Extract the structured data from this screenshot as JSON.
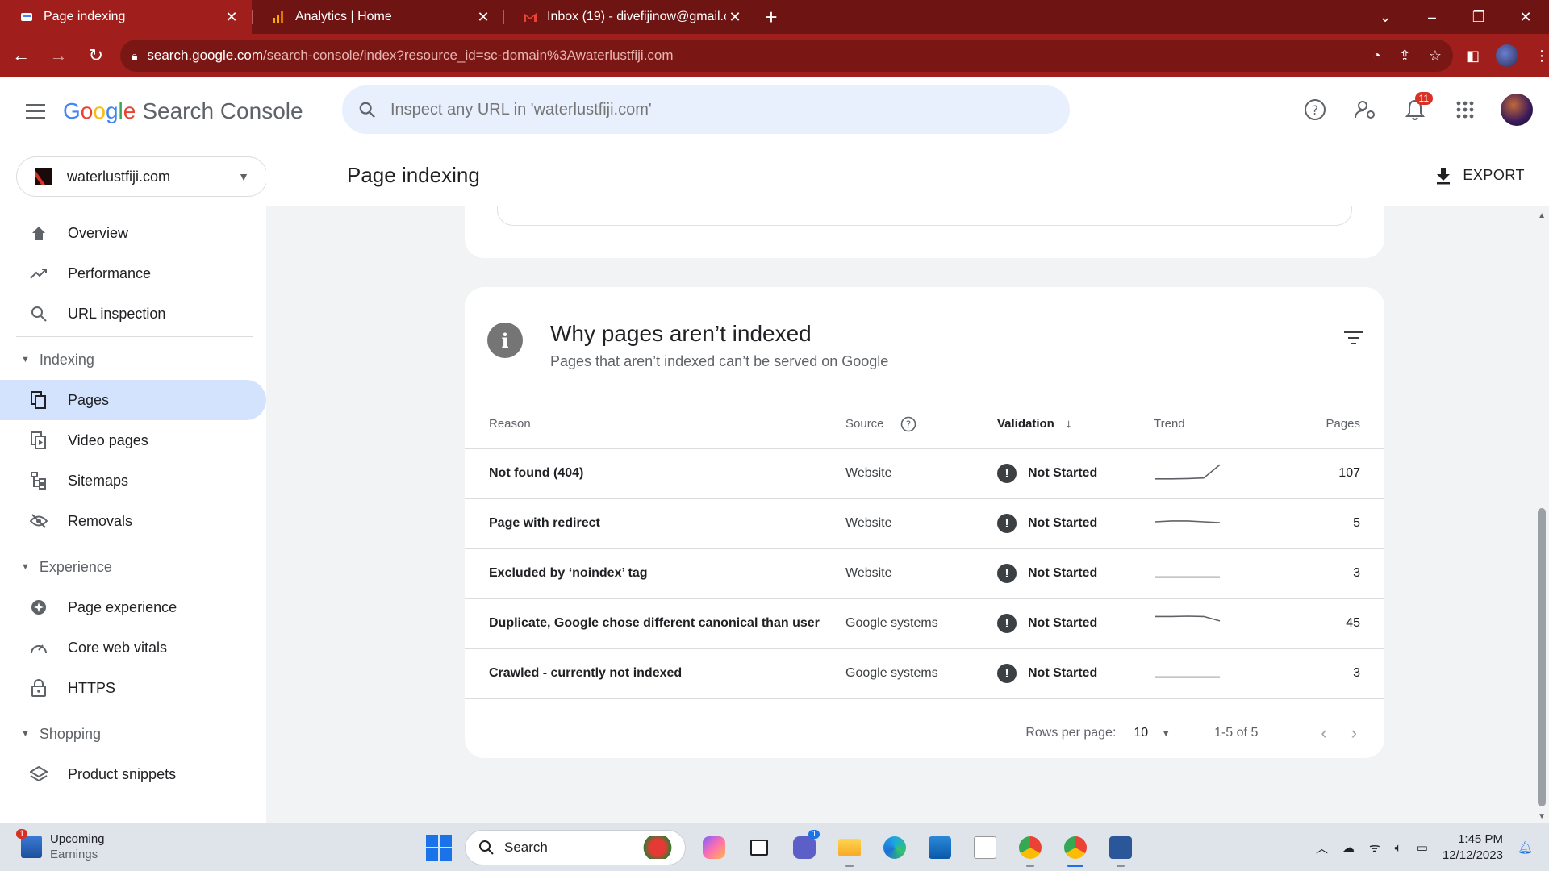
{
  "tabs": [
    {
      "title": "Page indexing",
      "active": true,
      "close": "✕",
      "favicon": "search-console-icon"
    },
    {
      "title": "Analytics | Home",
      "active": false,
      "close": "✕",
      "favicon": "analytics-icon"
    },
    {
      "title": "Inbox (19) - divefijinow@gmail.c",
      "active": false,
      "close": "✕",
      "favicon": "gmail-icon"
    }
  ],
  "new_tab": "+",
  "address": {
    "host": "search.google.com",
    "path": "/search-console/index?resource_id=sc-domain%3Awaterlustfiji.com"
  },
  "header": {
    "product": "Search Console",
    "search_placeholder": "Inspect any URL in 'waterlustfiji.com'",
    "notification_count": "11"
  },
  "property": {
    "name": "waterlustfiji.com"
  },
  "sidebar": {
    "top_items": [
      {
        "label": "Overview",
        "icon": "home-icon"
      },
      {
        "label": "Performance",
        "icon": "trending-up-icon"
      },
      {
        "label": "URL inspection",
        "icon": "search-icon"
      }
    ],
    "sections": [
      {
        "label": "Indexing",
        "items": [
          {
            "label": "Pages",
            "icon": "pages-icon",
            "selected": true
          },
          {
            "label": "Video pages",
            "icon": "video-pages-icon"
          },
          {
            "label": "Sitemaps",
            "icon": "sitemap-icon"
          },
          {
            "label": "Removals",
            "icon": "removals-icon"
          }
        ]
      },
      {
        "label": "Experience",
        "items": [
          {
            "label": "Page experience",
            "icon": "page-experience-icon"
          },
          {
            "label": "Core web vitals",
            "icon": "gauge-icon"
          },
          {
            "label": "HTTPS",
            "icon": "lock-icon"
          }
        ]
      },
      {
        "label": "Shopping",
        "items": [
          {
            "label": "Product snippets",
            "icon": "layers-icon"
          }
        ]
      }
    ]
  },
  "page": {
    "title": "Page indexing",
    "export_label": "EXPORT"
  },
  "card": {
    "title": "Why pages aren’t indexed",
    "subtitle": "Pages that aren’t indexed can’t be served on Google",
    "columns": {
      "reason": "Reason",
      "source": "Source",
      "validation": "Validation",
      "trend": "Trend",
      "pages": "Pages"
    },
    "rows": [
      {
        "reason": "Not found (404)",
        "source": "Website",
        "validation": "Not Started",
        "trend": [
          0.1,
          0.1,
          0.12,
          0.15,
          0.9
        ],
        "pages": "107"
      },
      {
        "reason": "Page with redirect",
        "source": "Website",
        "validation": "Not Started",
        "trend": [
          0.5,
          0.55,
          0.55,
          0.5,
          0.45
        ],
        "pages": "5"
      },
      {
        "reason": "Excluded by ‘noindex’ tag",
        "source": "Website",
        "validation": "Not Started",
        "trend": [
          0.2,
          0.2,
          0.2,
          0.2,
          0.2
        ],
        "pages": "3"
      },
      {
        "reason": "Duplicate, Google chose different canonical than user",
        "source": "Google systems",
        "validation": "Not Started",
        "trend": [
          0.8,
          0.8,
          0.82,
          0.8,
          0.55
        ],
        "pages": "45"
      },
      {
        "reason": "Crawled - currently not indexed",
        "source": "Google systems",
        "validation": "Not Started",
        "trend": [
          0.2,
          0.2,
          0.2,
          0.2,
          0.2
        ],
        "pages": "3"
      }
    ],
    "pager": {
      "rows_per_page_label": "Rows per page:",
      "rows_per_page": "10",
      "range": "1-5 of 5"
    }
  },
  "taskbar": {
    "weather_badge": "1",
    "weather_line1": "Upcoming",
    "weather_line2": "Earnings",
    "search_label": "Search",
    "teams_badge": "1",
    "time": "1:45 PM",
    "date": "12/12/2023"
  }
}
